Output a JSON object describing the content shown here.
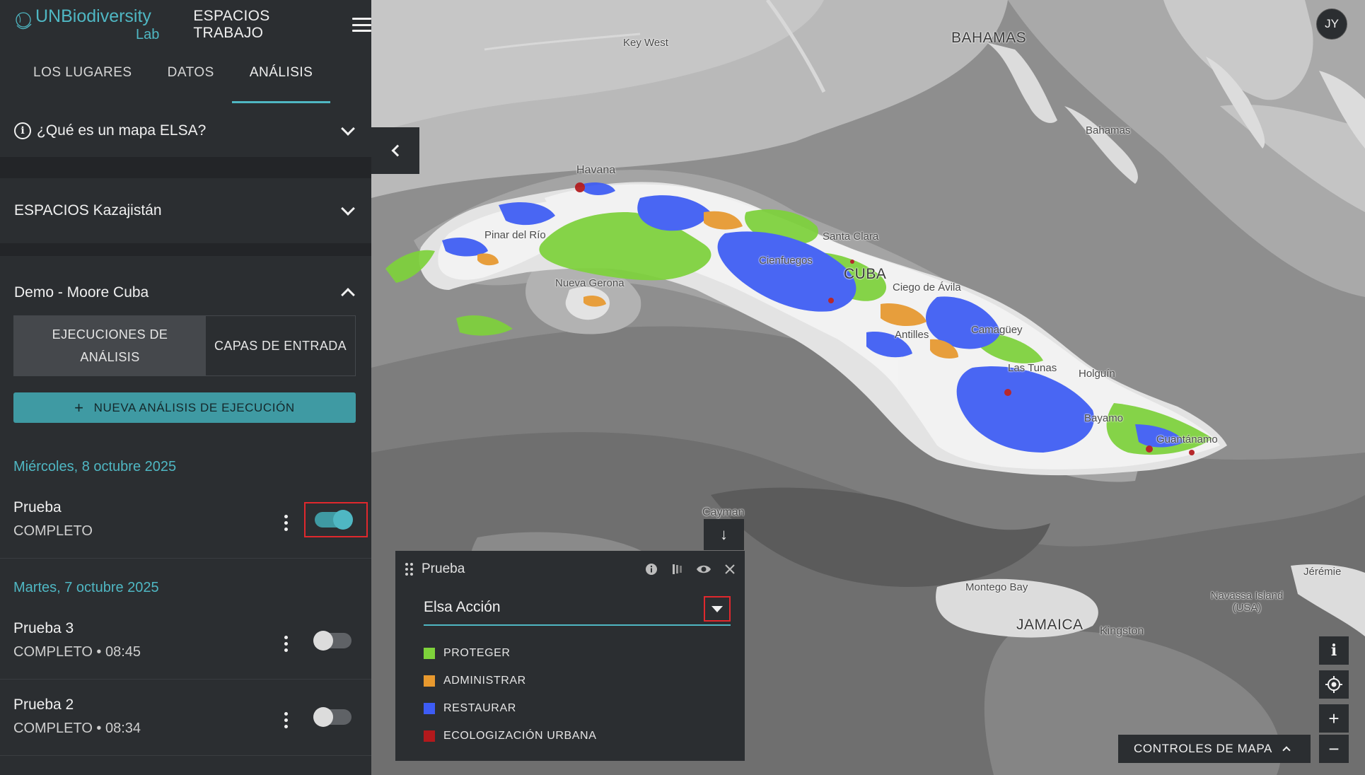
{
  "app": {
    "logo_text": "UNBiodiversity",
    "logo_sub": "Lab",
    "workspace_label": "ESPACIOS TRABAJO",
    "user_initials": "JY"
  },
  "tabs": [
    {
      "label": "LOS LUGARES"
    },
    {
      "label": "DATOS"
    },
    {
      "label": "ANÁLISIS"
    }
  ],
  "elsa_help": {
    "label": "¿Qué es un mapa ELSA?"
  },
  "space": {
    "label": "ESPACIOS Kazajistán"
  },
  "project": {
    "label": "Demo - Moore Cuba"
  },
  "segments": [
    {
      "label": "EJECUCIONES DE ANÁLISIS"
    },
    {
      "label": "CAPAS DE ENTRADA"
    }
  ],
  "new_run_button": {
    "label": "NUEVA ANÁLISIS DE EJECUCIÓN"
  },
  "runs": [
    {
      "date": "Miércoles, 8 octubre 2025",
      "name": "Prueba",
      "status": "COMPLETO",
      "enabled": true
    },
    {
      "date": "Martes, 7 octubre 2025",
      "name": "Prueba 3",
      "status": "COMPLETO • 08:45",
      "enabled": false
    },
    {
      "date": "",
      "name": "Prueba 2",
      "status": "COMPLETO • 08:34",
      "enabled": false
    }
  ],
  "legend": {
    "title": "Prueba",
    "select_value": "Elsa Acción",
    "items": [
      {
        "label": "PROTEGER",
        "color": "#7ed23b"
      },
      {
        "label": "ADMINISTRAR",
        "color": "#e8992e"
      },
      {
        "label": "RESTAURAR",
        "color": "#3d5cf5"
      },
      {
        "label": "ECOLOGIZACIÓN URBANA",
        "color": "#b3191c"
      }
    ]
  },
  "map": {
    "labels": {
      "bahamas_region": "BAHAMAS",
      "key_west": "Key West",
      "bahamas": "Bahamas",
      "havana": "Havana",
      "pinar": "Pinar del Río",
      "nueva_gerona": "Nueva Gerona",
      "santa_clara": "Santa Clara",
      "cienfuegos": "Cienfuegos",
      "cuba": "CUBA",
      "ciego": "Ciego de Ávila",
      "antilles": "Antilles",
      "camaguey": "Camagüey",
      "las_tunas": "Las Tunas",
      "holguin": "Holguín",
      "bayamo": "Bayamo",
      "guantanamo": "Guantánamo",
      "cayman": "Cayman",
      "montego": "Montego Bay",
      "jamaica": "JAMAICA",
      "kingston": "Kingston",
      "navassa": "Navassa Island (USA)",
      "jeremie": "Jérémie"
    },
    "controls_label": "CONTROLES DE MAPA",
    "colors": {
      "accent": "#4fb7c3",
      "panel": "#2b2e31",
      "highlight": "#e0282d"
    }
  }
}
